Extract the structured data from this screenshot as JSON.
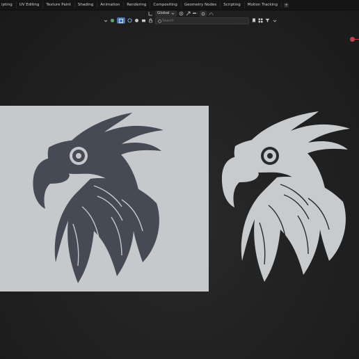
{
  "workspace_tabs": [
    "ipting",
    "UV Editing",
    "Texture Paint",
    "Shading",
    "Animation",
    "Rendering",
    "Compositing",
    "Geometry Nodes",
    "Scripting",
    "Motion Tracking"
  ],
  "add_tab_label": "+",
  "header": {
    "orientation_label": "Global",
    "search_placeholder": "Search"
  },
  "colors": {
    "background": "#1c1c1c",
    "image_plane": "#c6c9cc",
    "bird_dark": "#464a54",
    "bird_light": "#c8cbce",
    "accent": "#4772b3",
    "gizmo_x": "#c4414b"
  },
  "icons": [
    "view-layer-icon",
    "scene-icon",
    "mode-icon",
    "transform-orientation-icon",
    "snap-icon",
    "proportional-icon",
    "filter-icon"
  ]
}
